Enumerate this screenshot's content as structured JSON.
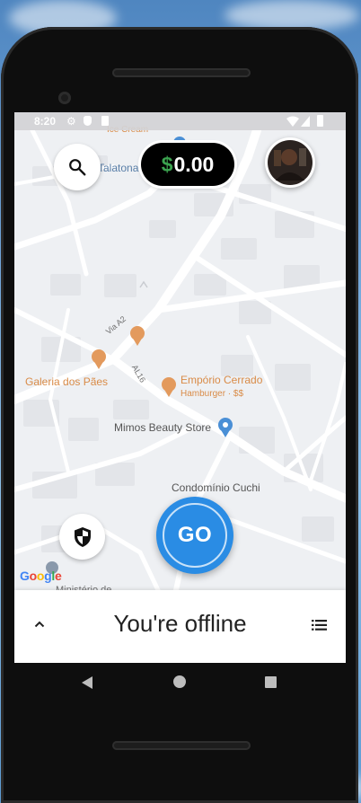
{
  "status_bar": {
    "time": "8:20"
  },
  "map": {
    "labels": {
      "street_top": "Talatona",
      "road_via_a2": "Via A2",
      "road_al16": "AL16",
      "galeria": "Galeria dos Pães",
      "emporio": "Empório Cerrado",
      "emporio_sub": "Hamburger · $$",
      "mimos": "Mimos Beauty Store",
      "condominio": "Condomínio Cuchi",
      "ministerio": "Ministério de",
      "cut_label_top": "Ice Cream"
    },
    "attribution": "Google"
  },
  "header": {
    "earnings": {
      "currency": "$",
      "amount": "0.00"
    }
  },
  "go_button": {
    "label": "GO"
  },
  "bottom_sheet": {
    "status": "You're offline"
  },
  "colors": {
    "go_blue": "#2a8ce4",
    "currency_green": "#3ba34f",
    "poi_orange": "#d98b47",
    "poi_blue": "#4a8fd6"
  },
  "icons": {
    "search": "search-icon",
    "safety": "shield-icon",
    "expand": "chevron-up-icon",
    "menu": "list-icon"
  }
}
